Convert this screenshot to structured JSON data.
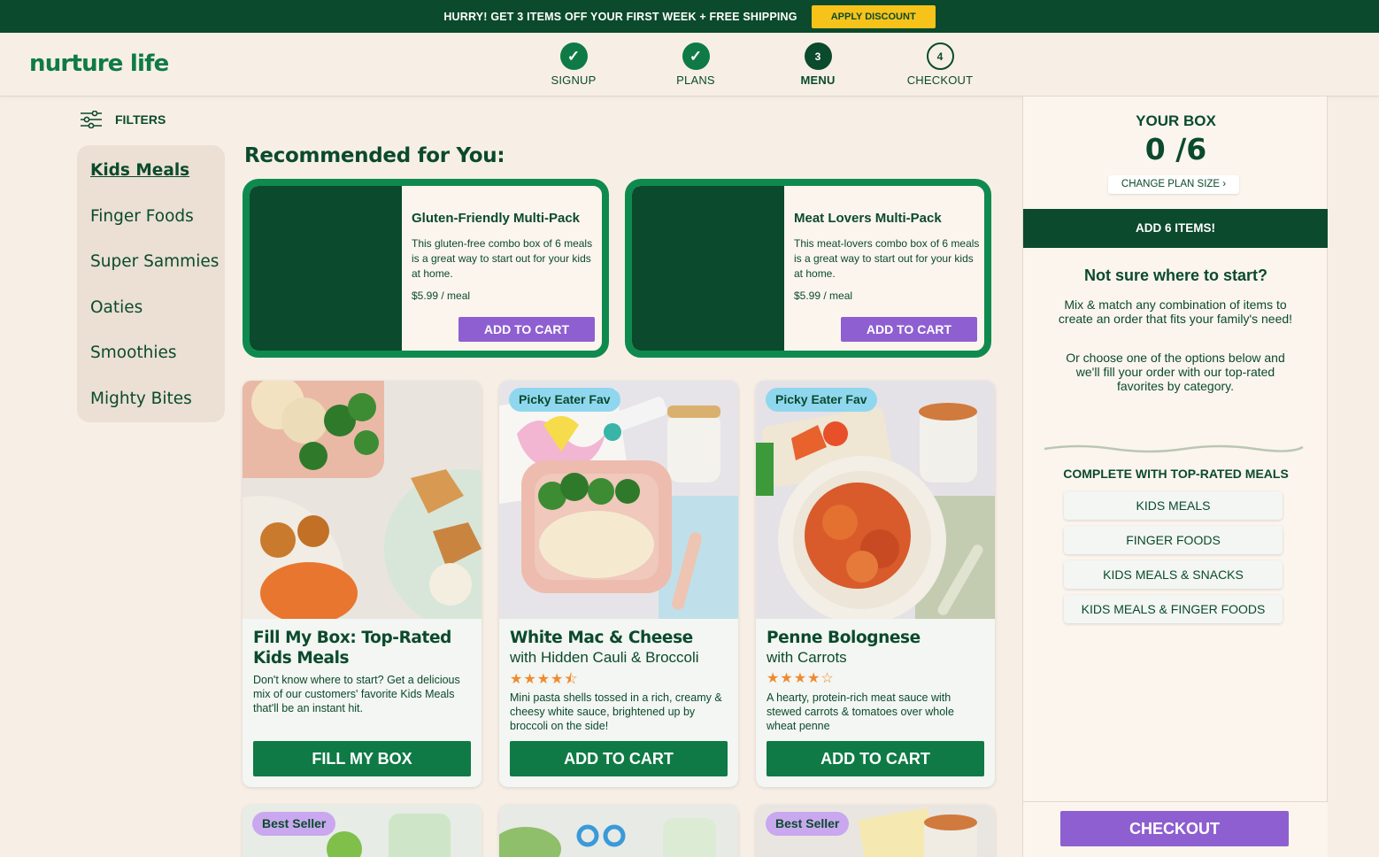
{
  "promo": {
    "text": "HURRY! GET 3 ITEMS OFF YOUR FIRST WEEK + FREE SHIPPING",
    "button": "APPLY DISCOUNT"
  },
  "header": {
    "logo": "nurture life",
    "steps": [
      {
        "label": "SIGNUP",
        "marker": "✓",
        "state": "done"
      },
      {
        "label": "PLANS",
        "marker": "✓",
        "state": "done"
      },
      {
        "label": "MENU",
        "marker": "3",
        "state": "current"
      },
      {
        "label": "CHECKOUT",
        "marker": "4",
        "state": "todo"
      }
    ]
  },
  "sidebar": {
    "filters_label": "FILTERS",
    "filters_icon": "sliders-icon",
    "categories": [
      {
        "label": "Kids Meals",
        "active": true
      },
      {
        "label": "Finger Foods",
        "active": false
      },
      {
        "label": "Super Sammies",
        "active": false
      },
      {
        "label": "Oaties",
        "active": false
      },
      {
        "label": "Smoothies",
        "active": false
      },
      {
        "label": "Mighty Bites",
        "active": false
      }
    ]
  },
  "recommended": {
    "title": "Recommended for You:",
    "cards": [
      {
        "name": "Gluten-Friendly Multi-Pack",
        "description": "This gluten-free combo box of 6 meals is a great way to start out for your kids at home.",
        "price": "$5.99 / meal",
        "button": "ADD TO CART"
      },
      {
        "name": "Meat Lovers Multi-Pack",
        "description": "This meat-lovers combo box of 6 meals is a great way to start out for your kids at home.",
        "price": "$5.99 / meal",
        "button": "ADD TO CART"
      }
    ]
  },
  "products": [
    {
      "title": "Fill My Box: Top-Rated Kids Meals",
      "subtitle": "",
      "rating": 0,
      "description": "Don't know where to start? Get a delicious mix of our customers' favorite Kids Meals that'll be an instant hit.",
      "button": "FILL MY BOX",
      "badge": ""
    },
    {
      "title": "White Mac & Cheese",
      "subtitle": "with Hidden Cauli & Broccoli",
      "rating": 4.5,
      "stars": "★★★★⯪",
      "description": "Mini pasta shells tossed in a rich, creamy & cheesy white sauce, brightened up by broccoli on the side!",
      "button": "ADD TO CART",
      "badge": "Picky Eater Fav"
    },
    {
      "title": "Penne Bolognese",
      "subtitle": "with Carrots",
      "rating": 4,
      "stars": "★★★★☆",
      "description": "A hearty, protein-rich meat sauce with stewed carrots & tomatoes over whole wheat penne",
      "button": "ADD TO CART",
      "badge": "Picky Eater Fav"
    }
  ],
  "products_row2": [
    {
      "badge": "Best Seller"
    },
    {
      "badge": ""
    },
    {
      "badge": "Best Seller"
    }
  ],
  "box": {
    "title": "YOUR BOX",
    "count": "0 /6",
    "change_plan": "CHANGE PLAN SIZE ›",
    "add_items": "ADD 6 ITEMS!",
    "not_sure_title": "Not sure where to start?",
    "p1": "Mix & match any combination of items to create an order that fits your family's need!",
    "p2": "Or choose one of the options below and we'll fill your order with our top-rated favorites by category.",
    "complete_title": "COMPLETE WITH TOP-RATED MEALS",
    "options": [
      "KIDS MEALS",
      "FINGER FOODS",
      "KIDS MEALS & SNACKS",
      "KIDS MEALS & FINGER FOODS"
    ],
    "checkout": "CHECKOUT"
  },
  "colors": {
    "brand_dark": "#0b4a2c",
    "brand_green": "#0f7a45",
    "accent_purple": "#8e5fd0",
    "promo_yellow": "#f7c31a",
    "background": "#f7efe6",
    "star": "#f08a2e"
  }
}
